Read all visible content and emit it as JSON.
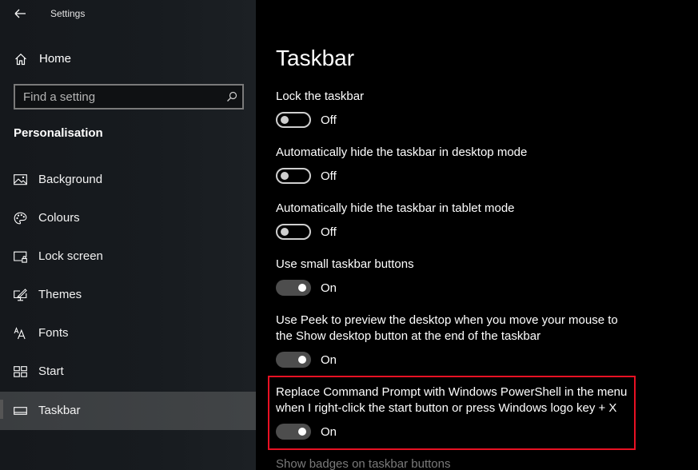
{
  "window": {
    "title": "Settings",
    "back_icon": "back-arrow-icon"
  },
  "sidebar": {
    "home": {
      "label": "Home",
      "icon": "home-icon"
    },
    "search": {
      "placeholder": "Find a setting",
      "value": "",
      "icon": "search-icon"
    },
    "section_title": "Personalisation",
    "items": [
      {
        "label": "Background",
        "icon": "picture-icon",
        "active": false
      },
      {
        "label": "Colours",
        "icon": "palette-icon",
        "active": false
      },
      {
        "label": "Lock screen",
        "icon": "lock-screen-icon",
        "active": false
      },
      {
        "label": "Themes",
        "icon": "themes-brush-icon",
        "active": false
      },
      {
        "label": "Fonts",
        "icon": "fonts-icon",
        "active": false
      },
      {
        "label": "Start",
        "icon": "start-tiles-icon",
        "active": false
      },
      {
        "label": "Taskbar",
        "icon": "taskbar-icon",
        "active": true
      }
    ]
  },
  "main": {
    "title": "Taskbar",
    "settings": [
      {
        "label": "Lock the taskbar",
        "state": "Off"
      },
      {
        "label": "Automatically hide the taskbar in desktop mode",
        "state": "Off"
      },
      {
        "label": "Automatically hide the taskbar in tablet mode",
        "state": "Off"
      },
      {
        "label": "Use small taskbar buttons",
        "state": "On"
      },
      {
        "label_line1": "Use Peek to preview the desktop when you move your mouse to",
        "label_line2": "the Show desktop button at the end of the taskbar",
        "state": "On"
      },
      {
        "label_line1": "Replace Command Prompt with Windows PowerShell in the menu",
        "label_line2": "when I right-click the start button or press Windows logo key + X",
        "state": "On",
        "highlighted": true
      }
    ],
    "next_setting_label": "Show badges on taskbar buttons",
    "highlight_color": "#e81123"
  }
}
